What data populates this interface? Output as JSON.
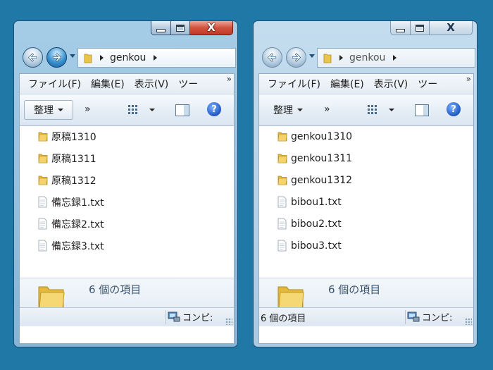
{
  "windows": [
    {
      "id": "left",
      "state": "active",
      "address": {
        "crumb": "genkou"
      },
      "menu": [
        "ファイル(F)",
        "編集(E)",
        "表示(V)",
        "ツー"
      ],
      "toolbar": {
        "organize_label": "整理",
        "more": "»"
      },
      "chevron": "»",
      "files": [
        {
          "name": "原稿1310",
          "type": "folder"
        },
        {
          "name": "原稿1311",
          "type": "folder"
        },
        {
          "name": "原稿1312",
          "type": "folder"
        },
        {
          "name": "備忘録1.txt",
          "type": "text"
        },
        {
          "name": "備忘録2.txt",
          "type": "text"
        },
        {
          "name": "備忘録3.txt",
          "type": "text"
        }
      ],
      "details_count": "6 個の項目",
      "status_left": "",
      "status_right": "コンピ:"
    },
    {
      "id": "right",
      "state": "inactive",
      "address": {
        "crumb": "genkou"
      },
      "menu": [
        "ファイル(F)",
        "編集(E)",
        "表示(V)",
        "ツー"
      ],
      "toolbar": {
        "organize_label": "整理",
        "more": "»"
      },
      "chevron": "»",
      "files": [
        {
          "name": "genkou1310",
          "type": "folder"
        },
        {
          "name": "genkou1311",
          "type": "folder"
        },
        {
          "name": "genkou1312",
          "type": "folder"
        },
        {
          "name": "bibou1.txt",
          "type": "text"
        },
        {
          "name": "bibou2.txt",
          "type": "text"
        },
        {
          "name": "bibou3.txt",
          "type": "text"
        }
      ],
      "details_count": "6 個の項目",
      "status_left": "6 個の項目",
      "status_right": "コンピ:"
    }
  ],
  "caption": {
    "close_glyph": "X"
  },
  "colors": {
    "desktop": "#1f78a6",
    "folder": "#e9c54b",
    "close_active": "#c8402a"
  },
  "icons": [
    "back-arrow-icon",
    "forward-arrow-icon",
    "folder-icon",
    "text-file-icon",
    "views-icon",
    "preview-pane-icon",
    "help-icon",
    "computer-icon"
  ]
}
